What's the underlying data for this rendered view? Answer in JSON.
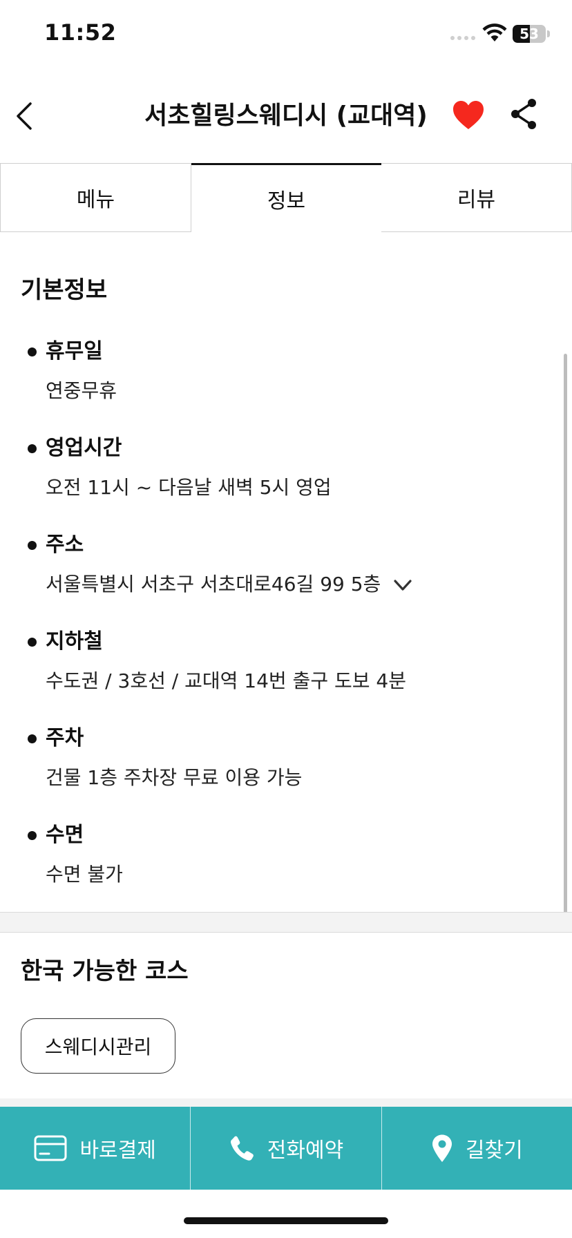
{
  "status_bar": {
    "time": "11:52",
    "battery_level": "53",
    "battery_fraction": 0.53,
    "signal_icon": "cellular-dots-icon",
    "wifi_icon": "wifi-icon"
  },
  "header": {
    "title": "서초힐링스웨디시 (교대역)",
    "back_icon": "chevron-left-icon",
    "favorite_icon": "heart-icon",
    "favorite_color": "#f5281e",
    "share_icon": "share-icon"
  },
  "tabs": [
    {
      "label": "메뉴",
      "active": false
    },
    {
      "label": "정보",
      "active": true
    },
    {
      "label": "리뷰",
      "active": false
    }
  ],
  "basic_info": {
    "title": "기본정보",
    "items": [
      {
        "label": "휴무일",
        "value": "연중무휴"
      },
      {
        "label": "영업시간",
        "value": "오전 11시  ~ 다음날 새벽 5시  영업"
      },
      {
        "label": "주소",
        "value": "서울특별시 서초구 서초대로46길 99 5층",
        "expand_icon": "chevron-down-icon"
      },
      {
        "label": "지하철",
        "value": "수도권 / 3호선 / 교대역 14번 출구 도보 4분"
      },
      {
        "label": "주차",
        "value": "건물 1층 주차장 무료 이용 가능"
      },
      {
        "label": "수면",
        "value": "수면 불가"
      }
    ]
  },
  "courses": {
    "title": "한국 가능한 코스",
    "chips": [
      "스웨디시관리"
    ]
  },
  "action_bar": {
    "background_color": "#33b1b6",
    "buttons": [
      {
        "label": "바로결제",
        "icon": "credit-card-icon"
      },
      {
        "label": "전화예약",
        "icon": "phone-icon"
      },
      {
        "label": "길찾기",
        "icon": "map-pin-icon"
      }
    ]
  }
}
